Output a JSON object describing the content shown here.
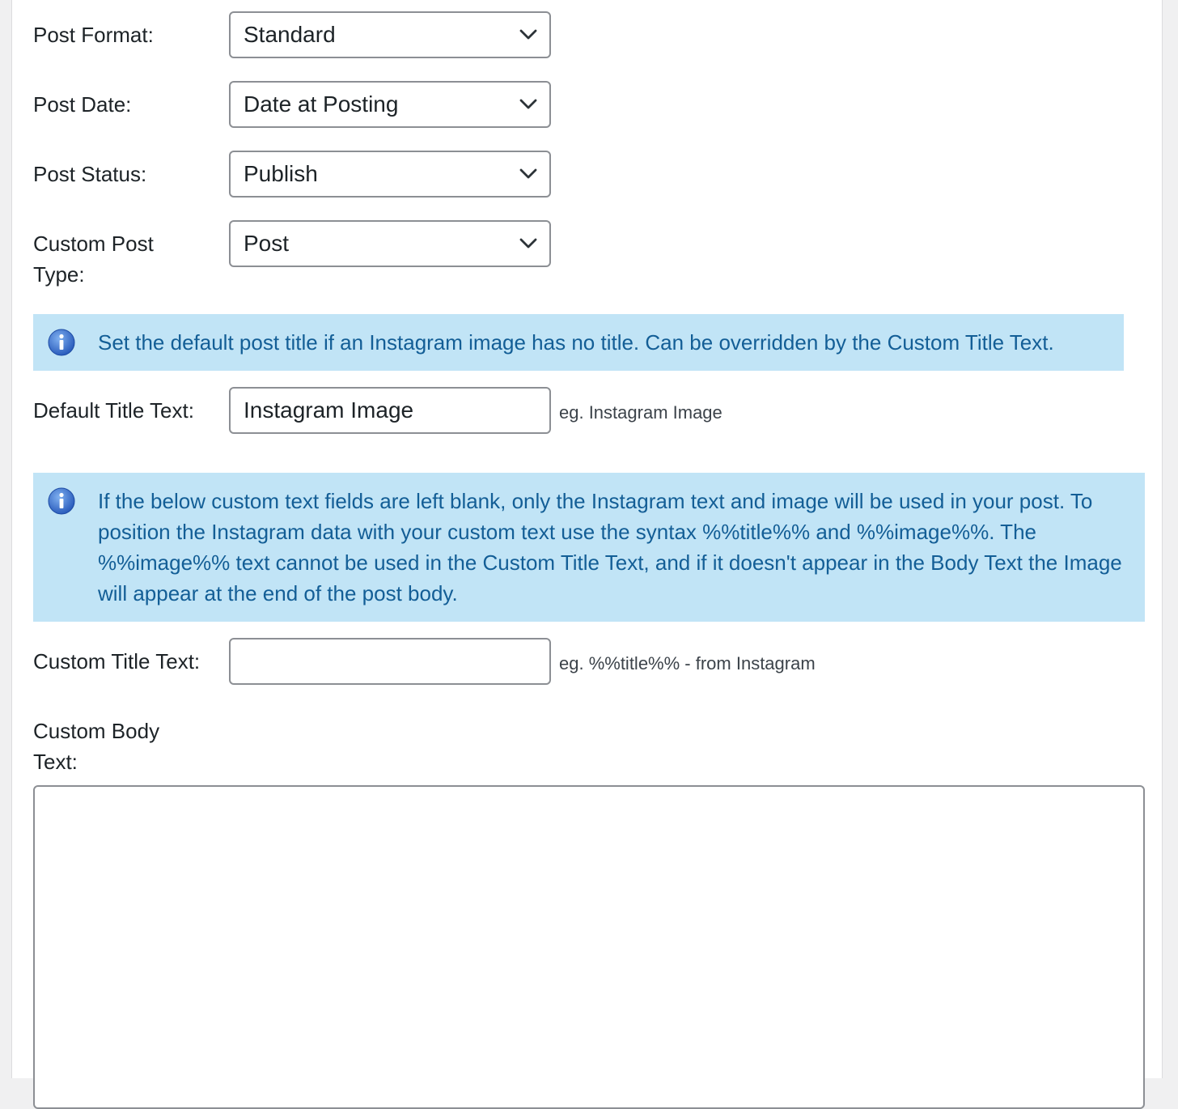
{
  "fields": {
    "post_format": {
      "label": "Post Format:",
      "value": "Standard"
    },
    "post_date": {
      "label": "Post Date:",
      "value": "Date at Posting"
    },
    "post_status": {
      "label": "Post Status:",
      "value": "Publish"
    },
    "custom_post_type": {
      "label_line1": "Custom Post",
      "label_line2": "Type:",
      "value": "Post"
    },
    "default_title": {
      "label": "Default Title Text:",
      "value": "Instagram Image",
      "hint": "eg. Instagram Image"
    },
    "custom_title": {
      "label": "Custom Title Text:",
      "value": "",
      "hint": "eg. %%title%% - from Instagram"
    },
    "custom_body": {
      "label_line1": "Custom Body",
      "label_line2": "Text:",
      "value": ""
    }
  },
  "notices": {
    "default_title_notice": "Set the default post title if an Instagram image has no title. Can be overridden by the Custom Title Text.",
    "custom_text_notice": "If the below custom text fields are left blank, only the Instagram text and image will be used in your post. To position the Instagram data with your custom text use the syntax %%title%% and %%image%%. The %%image%% text cannot be used in the Custom Title Text, and if it doesn't appear in the Body Text the Image will appear at the end of the post body."
  },
  "colors": {
    "notice_background": "#c1e4f6",
    "notice_text": "#135e96",
    "info_icon": "#2f6fd1"
  }
}
